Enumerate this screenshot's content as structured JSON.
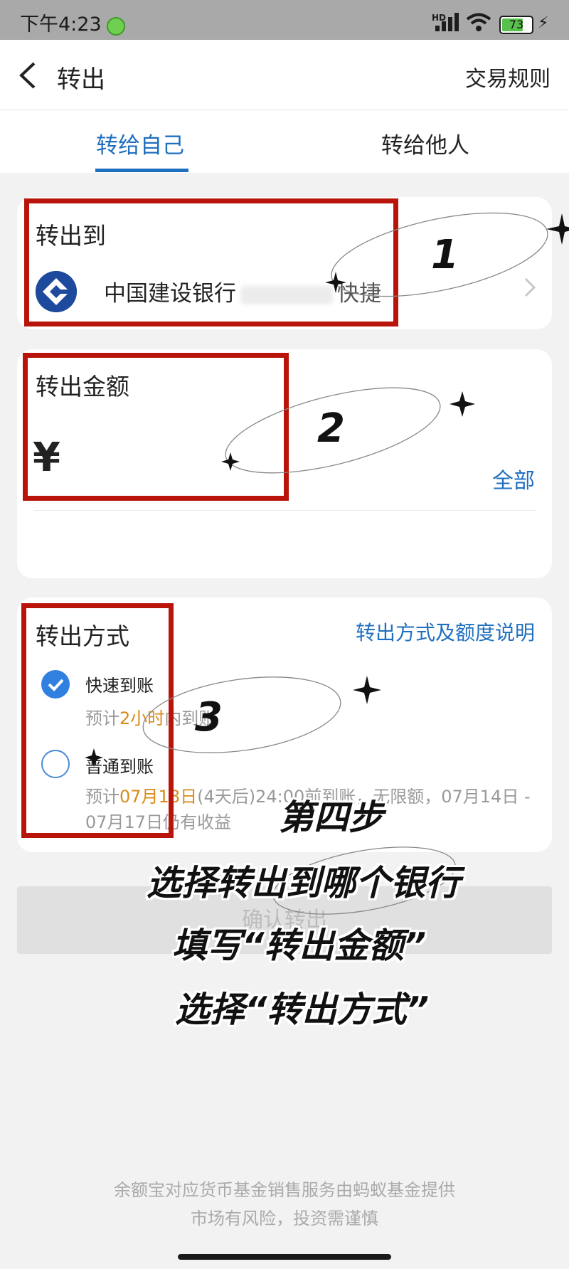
{
  "status_bar": {
    "time": "下午4:23",
    "network": "HD",
    "battery_percent": "73",
    "battery_level": 0.73
  },
  "nav": {
    "title": "转出",
    "right_action": "交易规则"
  },
  "tabs": [
    {
      "label": "转给自己",
      "active": true
    },
    {
      "label": "转给他人",
      "active": false
    }
  ],
  "destination": {
    "title": "转出到",
    "bank_name": "中国建设银行",
    "bank_suffix": "快捷"
  },
  "amount": {
    "title": "转出金额",
    "currency_symbol": "¥",
    "all_label": "全部"
  },
  "method": {
    "title": "转出方式",
    "info_link": "转出方式及额度说明",
    "options": [
      {
        "label": "快速到账",
        "desc_prefix": "预计",
        "desc_highlight": "2小时",
        "desc_suffix": "内到账",
        "selected": true
      },
      {
        "label": "普通到账",
        "desc_prefix": "预计",
        "desc_highlight": "07月18日",
        "desc_suffix": "(4天后)24:00前到账，无限额，07月14日 - 07月17日仍有收益",
        "selected": false
      }
    ]
  },
  "confirm_label": "确认转出",
  "footer": {
    "line1": "余额宝对应货币基金销售服务由蚂蚁基金提供",
    "line2": "市场有风险，投资需谨慎"
  },
  "annotations": {
    "step_numbers": [
      "1",
      "2",
      "3"
    ],
    "caption_lines": [
      "第四步",
      "选择转出到哪个银行",
      "填写“转出金额”",
      "选择“转出方式”"
    ],
    "box_color": "#b8140a"
  },
  "colors": {
    "accent_blue": "#1f6fbf",
    "highlight_orange": "#d98a1a",
    "bank_logo_blue": "#1d4a9c"
  }
}
